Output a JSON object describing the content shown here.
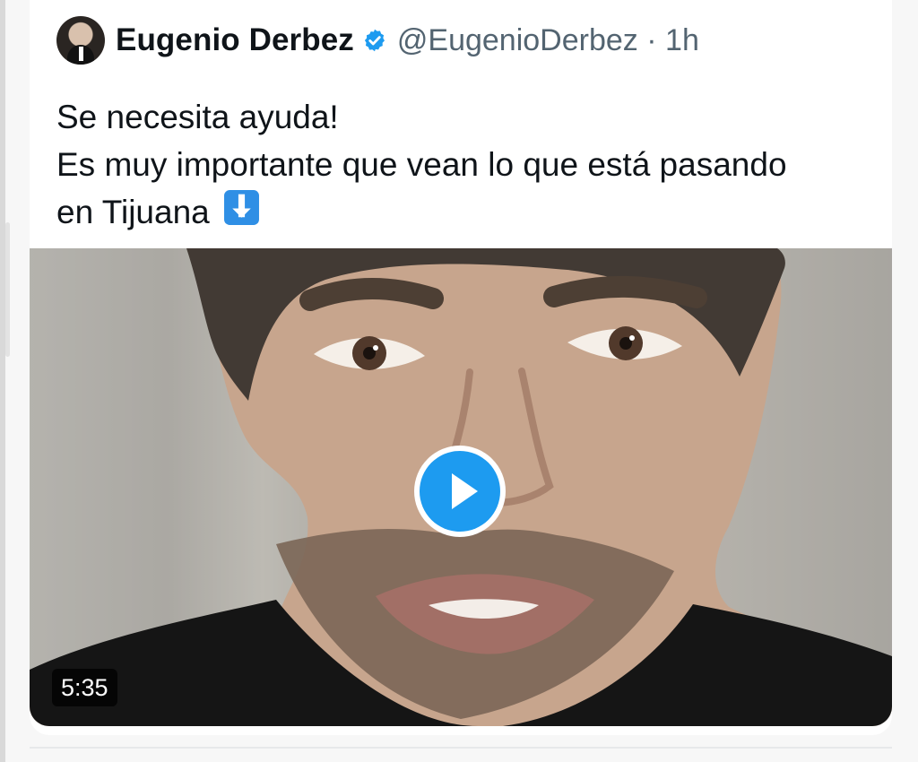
{
  "tweet": {
    "author": {
      "name": "Eugenio Derbez",
      "handle": "@EugenioDerbez",
      "separator": "·",
      "time": "1h",
      "verified": true,
      "avatar_icon": "profile-photo"
    },
    "text_lines": [
      "Se necesita ayuda!",
      "Es muy importante que vean lo que está pasando",
      "en Tijuana"
    ],
    "emoji": "down-arrow-emoji",
    "media": {
      "type": "video",
      "duration": "5:35",
      "play_icon": "play-icon"
    }
  },
  "colors": {
    "text": "#0f1419",
    "secondary": "#536471",
    "accent": "#1d9bf0",
    "background": "#ffffff"
  }
}
